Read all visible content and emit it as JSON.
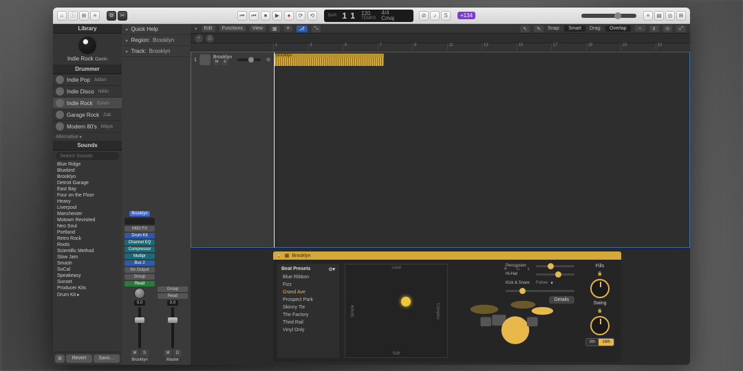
{
  "toolbar": {
    "transport": {
      "rewind": "⏮",
      "stop": "⏹",
      "play": "▶",
      "record": "●",
      "cycle": "⟳"
    },
    "lcd": {
      "bars": "1",
      "beats": "1",
      "bar_lbl": "BAR",
      "beat_lbl": "BEAT",
      "tempo": "120",
      "tempo_lbl": "TEMPO",
      "sig": "4/4",
      "key": "Cmaj"
    },
    "account": "+134",
    "view_btns": [
      "⊞",
      "≡",
      "⊡",
      "⊟"
    ]
  },
  "library": {
    "title": "Library",
    "genre": "Indie Rock",
    "drummer_name": "Gavin",
    "section_drummer": "Drummer",
    "drummers": [
      {
        "style": "Indie Pop",
        "name": "Aidan"
      },
      {
        "style": "Indie Disco",
        "name": "Nikki"
      },
      {
        "style": "Indie Rock",
        "name": "Gavin",
        "selected": true
      },
      {
        "style": "Garage Rock",
        "name": "Zak"
      },
      {
        "style": "Modern 80's",
        "name": "Maya"
      }
    ],
    "alternative": "Alternative ▸",
    "section_sounds": "Sounds",
    "search_ph": "Search Sounds",
    "sounds": [
      "Blue Ridge",
      "Bluebird",
      "Brooklyn",
      "Detroit Garage",
      "East Bay",
      "Four on the Floor",
      "Heavy",
      "Liverpool",
      "Manchester",
      "Motown Revisited",
      "Neo Soul",
      "Portland",
      "Retro Rock",
      "Roots",
      "Scientific Method",
      "Slow Jam",
      "Smash",
      "SoCal",
      "Speakeasy",
      "Sunset",
      "Producer Kits",
      "Drum Kit ▸"
    ],
    "revert": "Revert",
    "save": "Savo…"
  },
  "inspector": {
    "quick_help": "Quick Help",
    "region_lbl": "Region:",
    "region_val": "Brooklyn",
    "track_lbl": "Track:",
    "track_val": "Brooklyn",
    "strip": {
      "name": "Brooklyn",
      "midifx": "MIDI FX",
      "inst": "Drum Kit",
      "fx": [
        "Channel EQ",
        "Compressor",
        "Multipr"
      ],
      "send": "Bus 2",
      "output": "No Output",
      "group": "Group",
      "read": "Read",
      "db": "0.0",
      "mute": "M",
      "solo": "S"
    },
    "master": {
      "group": "Group",
      "read": "Read",
      "db": "0.0",
      "mute": "M",
      "dim": "D",
      "name": "Master"
    }
  },
  "track_bar": {
    "edit": "Edit",
    "functions": "Functions",
    "view": "View",
    "snap_lbl": "Snap:",
    "snap_val": "Smart",
    "drag_lbl": "Drag:",
    "drag_val": "Overlap"
  },
  "ruler": [
    "1",
    "3",
    "5",
    "7",
    "9",
    "11",
    "13",
    "15",
    "17",
    "19",
    "21",
    "23"
  ],
  "track": {
    "index": "1",
    "name": "Brooklyn",
    "mute": "M",
    "solo": "S",
    "region": "Brooklyn"
  },
  "editor": {
    "title": "Brooklyn",
    "presets_lbl": "Beat Presets",
    "presets": [
      "Blue Ribbon",
      "Fizz",
      "Grand Ave",
      "Prospect Park",
      "Skinny Tie",
      "The Factory",
      "Third Rail",
      "Vinyl Only"
    ],
    "preset_selected": "Grand Ave",
    "xy": {
      "loud": "Loud",
      "soft": "Soft",
      "simple": "Simple",
      "complex": "Complex"
    },
    "kit": {
      "percussion": "Percussion",
      "hihat": "Hi-Hat",
      "kicksnare": "Kick & Snare",
      "follow": "Follow"
    },
    "fills": "Fills",
    "swing": "Swing",
    "eighth": "8th",
    "sixteenth": "16th",
    "details": "Details"
  }
}
